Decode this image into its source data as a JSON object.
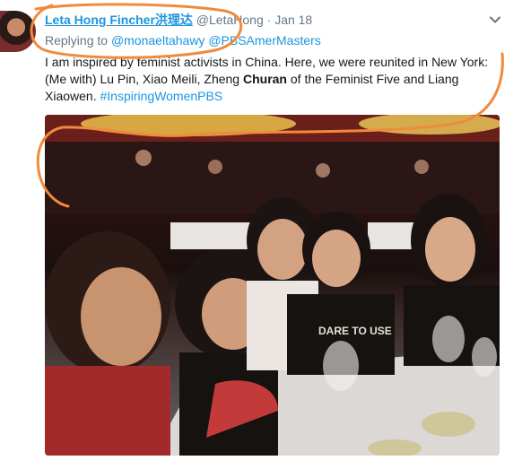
{
  "tweet": {
    "author_name": "Leta Hong Fincher洪理达",
    "handle": "@LetaHong",
    "dot": "·",
    "date": "Jan 18",
    "replying_prefix": "Replying to",
    "reply_to_1": "@monaeltahawy",
    "reply_to_2": "@PBSAmerMasters",
    "text_part1": "I am inspired by feminist activists in China. Here, we were reunited in New York: (Me with) Lu Pin, Xiao Meili, Zheng ",
    "text_bold": "Churan",
    "text_part2": " of the Feminist Five and Liang Xiaowen. ",
    "hashtag": "#InspiringWomenPBS",
    "photo_alt": "DARE TO USE"
  },
  "icons": {
    "chevron": "chevron-down-icon"
  },
  "colors": {
    "link": "#1b95e0",
    "secondary": "#657786",
    "annotation": "#f08a3c"
  }
}
